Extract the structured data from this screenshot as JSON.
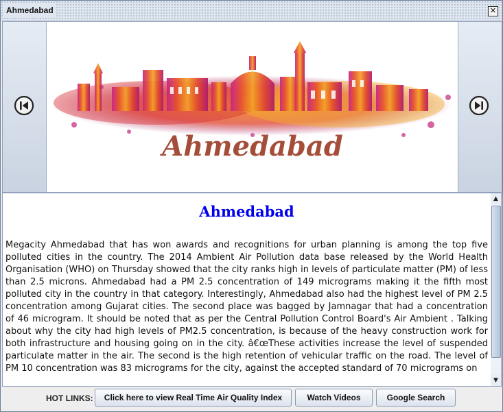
{
  "window": {
    "title": "Ahmedabad",
    "close_symbol": "✕"
  },
  "banner": {
    "image_caption": "Ahmedabad"
  },
  "article": {
    "title": "Ahmedabad",
    "body": "Megacity Ahmedabad that has won awards and recognitions for urban planning is among the top five polluted cities in the country. The 2014 Ambient Air Pollution data base released by the World Health Organisation (WHO) on Thursday showed that the city ranks high in levels of particulate matter (PM) of less than 2.5 microns. Ahmedabad had a PM 2.5 concentration of 149 micrograms making it the fifth most polluted city in the country in that category. Interestingly, Ahmedabad also had the highest level of PM 2.5 concentration among Gujarat cities. The second place was bagged by Jamnagar that had a concentration of 46 microgram. It should be noted that as per the Central Pollution Control Board's Air Ambient . Talking about why the city had high levels of PM2.5 concentration, is because of the heavy construction work for both infrastructure and housing going on in the city. â€œThese activities increase the level of suspended particulate matter in the air. The second is the high retention of vehicular traffic on the road. The level of PM 10 concentration was 83 micrograms for the city, against the accepted standard of 70 micrograms on"
  },
  "scrollbar": {
    "up_symbol": "▲",
    "down_symbol": "▼"
  },
  "footer": {
    "label": "HOT LINKS:",
    "aqi_button": "Click here to view Real Time Air Quality Index",
    "videos_button": "Watch Videos",
    "google_button": "Google Search"
  },
  "colors": {
    "title_blue": "#0000ee",
    "chrome_blue": "#dfe6ef"
  },
  "icons": {
    "prev": "skip-back-icon",
    "next": "skip-forward-icon"
  }
}
